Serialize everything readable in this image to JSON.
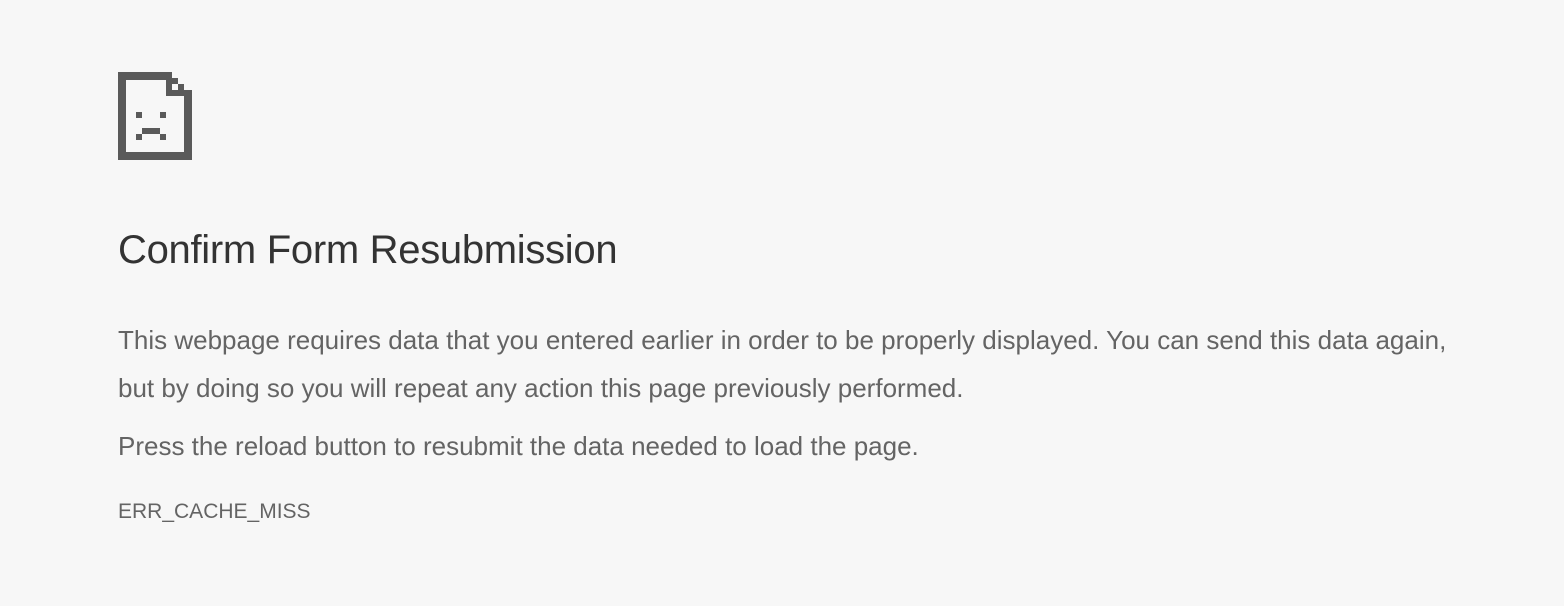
{
  "icon": "sad-page-icon",
  "title": "Confirm Form Resubmission",
  "description": "This webpage requires data that you entered earlier in order to be properly displayed. You can send this data again, but by doing so you will repeat any action this page previously performed.",
  "instruction": "Press the reload button to resubmit the data needed to load the page.",
  "error_code": "ERR_CACHE_MISS",
  "colors": {
    "background": "#f7f7f7",
    "title": "#333333",
    "text": "#646464",
    "icon": "#5a5a5a"
  }
}
